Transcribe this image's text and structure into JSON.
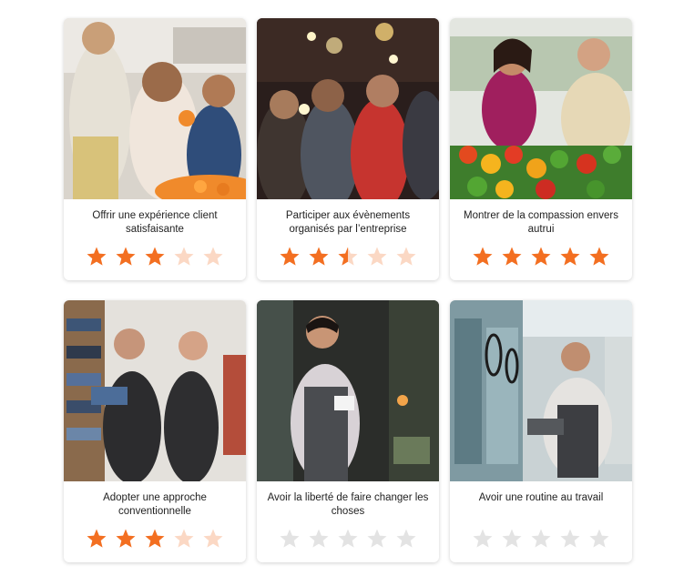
{
  "colors": {
    "filled": "#f36f21",
    "faded": "#fbd8c4",
    "empty": "#e3e3e3"
  },
  "cards": [
    {
      "label": "Offrir une expérience client satisfaisante",
      "rating": 3,
      "faded": 2,
      "image": "shoppers-with-oranges-photo"
    },
    {
      "label": "Participer aux évènements organisés par l’entreprise",
      "rating": 2.5,
      "faded": 2,
      "image": "party-sparklers-photo"
    },
    {
      "label": "Montrer de la compassion envers autrui",
      "rating": 5,
      "faded": 0,
      "image": "produce-market-photo"
    },
    {
      "label": "Adopter une approche conventionnelle",
      "rating": 3,
      "faded": 2,
      "image": "clothing-store-staff-photo"
    },
    {
      "label": "Avoir la liberté de faire changer les choses",
      "rating": 0,
      "faded": 0,
      "image": "smiling-waiter-photo"
    },
    {
      "label": "Avoir une routine au travail",
      "rating": 0,
      "faded": 0,
      "image": "grocery-worker-tablet-photo"
    }
  ]
}
